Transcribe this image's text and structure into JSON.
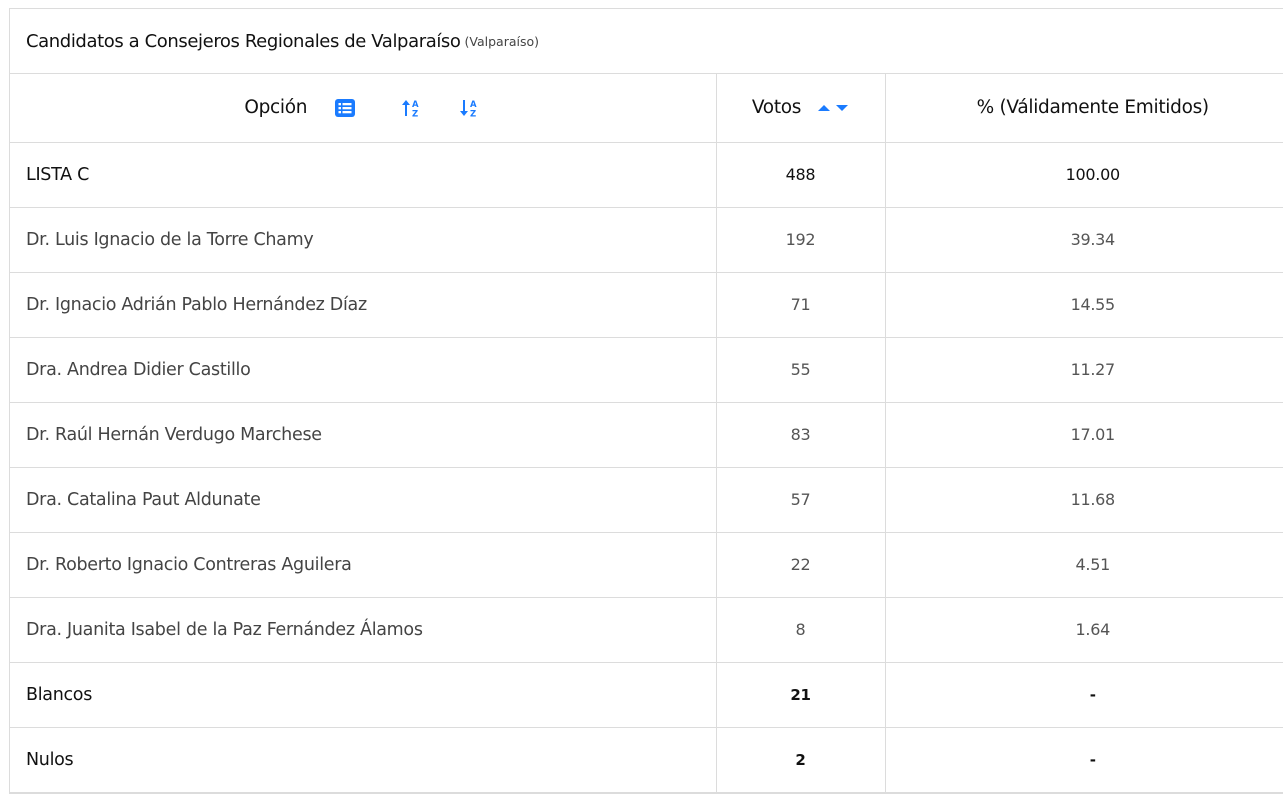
{
  "title": {
    "main": "Candidatos a Consejeros Regionales de Valparaíso",
    "sub": "(Valparaíso)"
  },
  "columns": {
    "option": "Opción",
    "votes": "Votos",
    "percent": "% (Válidamente Emitidos)"
  },
  "icons": {
    "list": "list-icon",
    "sort_asc": "sort-alpha-up-icon",
    "sort_desc": "sort-alpha-down-icon",
    "caret_up": "caret-up-icon",
    "caret_down": "caret-down-icon"
  },
  "colors": {
    "accent": "#1a7bff",
    "border": "#dcdcdc"
  },
  "rows": [
    {
      "name": "LISTA C",
      "votes": "488",
      "percent": "100.00"
    },
    {
      "name": "Dr. Luis Ignacio de la Torre Chamy",
      "votes": "192",
      "percent": "39.34"
    },
    {
      "name": "Dr. Ignacio Adrián Pablo Hernández Díaz",
      "votes": "71",
      "percent": "14.55"
    },
    {
      "name": "Dra. Andrea Didier Castillo",
      "votes": "55",
      "percent": "11.27"
    },
    {
      "name": "Dr. Raúl Hernán Verdugo Marchese",
      "votes": "83",
      "percent": "17.01"
    },
    {
      "name": "Dra. Catalina Paut Aldunate",
      "votes": "57",
      "percent": "11.68"
    },
    {
      "name": "Dr. Roberto Ignacio Contreras Aguilera",
      "votes": "22",
      "percent": "4.51"
    },
    {
      "name": "Dra. Juanita Isabel de la Paz Fernández Álamos",
      "votes": "8",
      "percent": "1.64"
    },
    {
      "name": "Blancos",
      "votes": "21",
      "percent": "-"
    },
    {
      "name": "Nulos",
      "votes": "2",
      "percent": "-"
    }
  ]
}
